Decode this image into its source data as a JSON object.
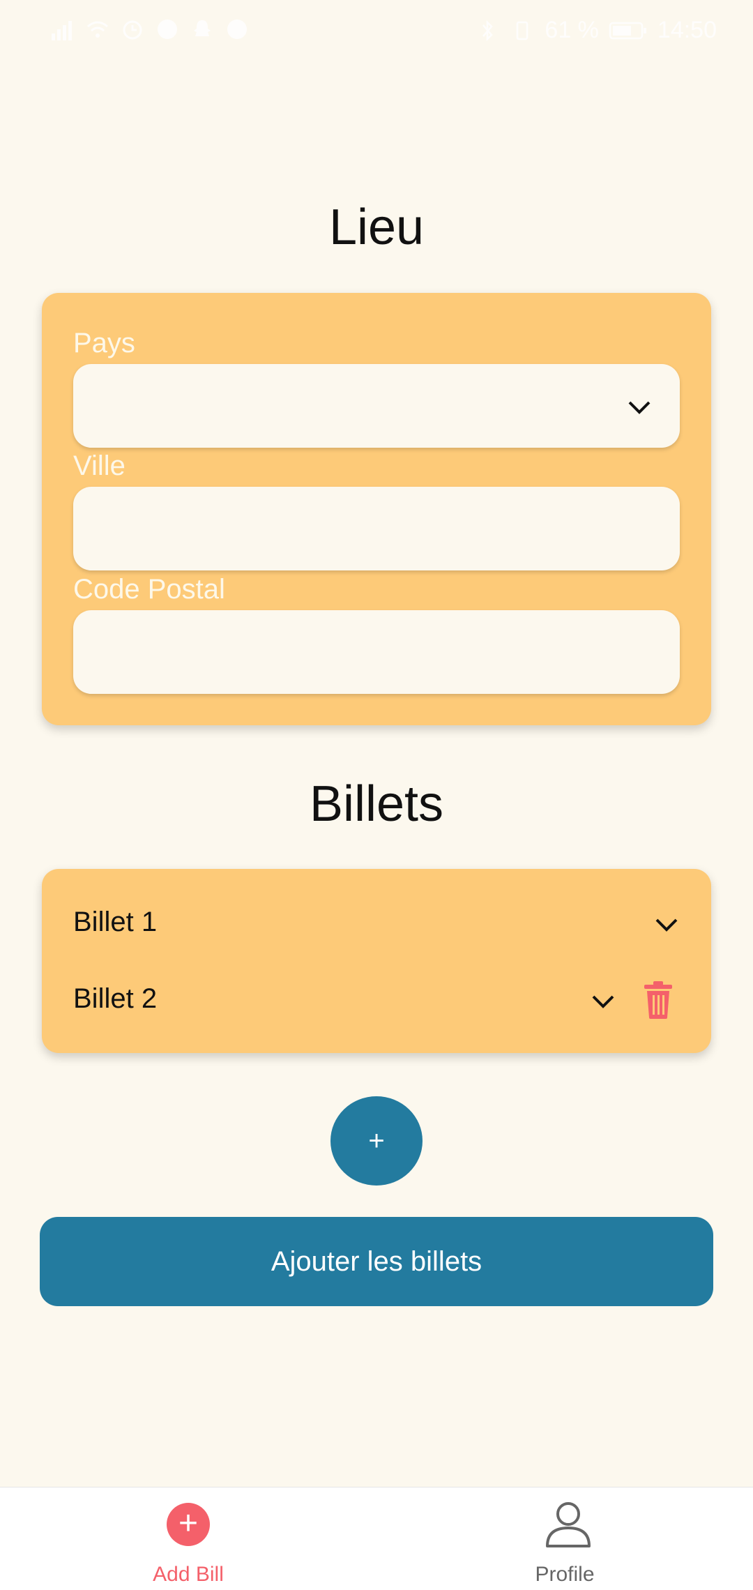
{
  "status_bar": {
    "battery": "61 %",
    "time": "14:50"
  },
  "sections": {
    "lieu_title": "Lieu",
    "billets_title": "Billets"
  },
  "lieu_form": {
    "pays_label": "Pays",
    "pays_value": "",
    "ville_label": "Ville",
    "ville_value": "",
    "code_postal_label": "Code Postal",
    "code_postal_value": ""
  },
  "billets": {
    "items": [
      {
        "label": "Billet 1"
      },
      {
        "label": "Billet 2"
      }
    ]
  },
  "actions": {
    "add_billet_label": "+",
    "submit_label": "Ajouter les billets"
  },
  "bottom_nav": {
    "items": [
      {
        "label": "Add Bill",
        "icon": "add-circle-icon",
        "active": true
      },
      {
        "label": "Profile",
        "icon": "person-icon",
        "active": false
      }
    ]
  },
  "colors": {
    "background": "#fcf8ee",
    "card": "#fdca78",
    "primary": "#237b9f",
    "accent": "#f4606a"
  }
}
